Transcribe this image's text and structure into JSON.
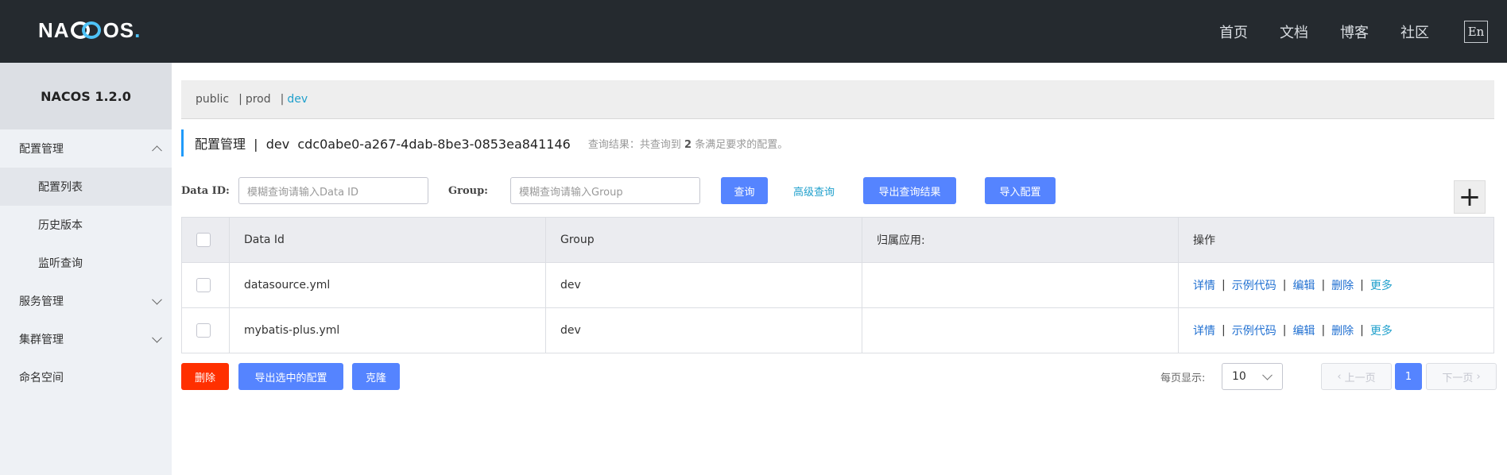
{
  "topbar": {
    "logo_left": "NA",
    "logo_right": "OS",
    "logo_dot": ".",
    "nav": [
      "首页",
      "文档",
      "博客",
      "社区"
    ],
    "lang": "En"
  },
  "sidebar": {
    "title": "NACOS 1.2.0",
    "groups": [
      {
        "label": "配置管理",
        "expanded": true,
        "children": [
          "配置列表",
          "历史版本",
          "监听查询"
        ]
      },
      {
        "label": "服务管理",
        "expanded": false
      },
      {
        "label": "集群管理",
        "expanded": false
      },
      {
        "label": "命名空间"
      }
    ],
    "active_child": "配置列表"
  },
  "namespaces": {
    "items": [
      "public",
      "prod",
      "dev"
    ],
    "separator": "|",
    "active": "dev"
  },
  "page": {
    "title": "配置管理  |  dev  cdc0abe0-a267-4dab-8be3-0853ea841146",
    "hint_prefix": "查询结果：共查询到",
    "hint_count": "2",
    "hint_suffix": "条满足要求的配置。"
  },
  "search": {
    "dataid_label": "Data ID:",
    "dataid_placeholder": "模糊查询请输入Data ID",
    "group_label": "Group:",
    "group_placeholder": "模糊查询请输入Group",
    "query_btn": "查询",
    "advanced_btn": "高级查询",
    "export_result_btn": "导出查询结果",
    "import_btn": "导入配置",
    "add_btn": "+"
  },
  "table": {
    "headers": [
      "Data Id",
      "Group",
      "归属应用:",
      "操作"
    ],
    "rows": [
      {
        "data_id": "datasource.yml",
        "group": "dev",
        "app": ""
      },
      {
        "data_id": "mybatis-plus.yml",
        "group": "dev",
        "app": ""
      }
    ],
    "ops": [
      "详情",
      "示例代码",
      "编辑",
      "删除",
      "更多"
    ],
    "op_sep": "|"
  },
  "footer": {
    "delete_btn": "删除",
    "export_selected_btn": "导出选中的配置",
    "clone_btn": "克隆",
    "page_size_label": "每页显示:",
    "page_size": "10",
    "prev": "上一页",
    "current_page": "1",
    "next": "下一页"
  },
  "colors": {
    "topbar": "#252a2f",
    "primary": "#5584ff",
    "danger": "#ff3000",
    "link": "#1f6fd1",
    "accent": "#20a0cc"
  }
}
